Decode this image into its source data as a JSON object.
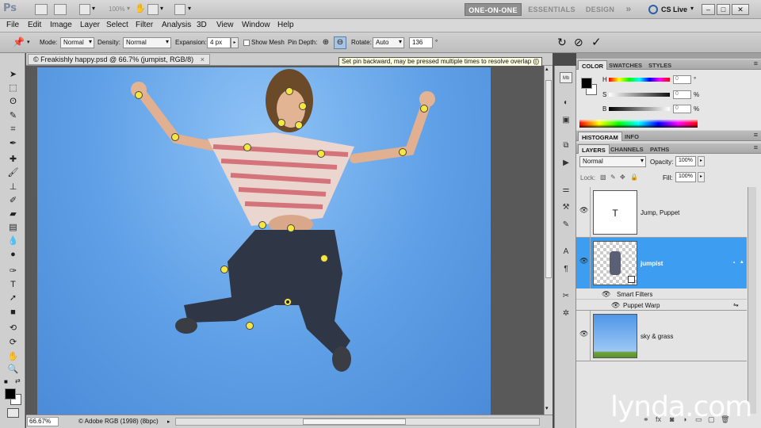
{
  "app": {
    "logo": "Ps",
    "zoom_select": "100%",
    "workspaces": [
      "ONE-ON-ONE",
      "ESSENTIALS",
      "DESIGN"
    ],
    "more_workspaces": "»",
    "cs_live": "CS Live"
  },
  "menu": [
    "File",
    "Edit",
    "Image",
    "Layer",
    "Select",
    "Filter",
    "Analysis",
    "3D",
    "View",
    "Window",
    "Help"
  ],
  "options": {
    "mode_label": "Mode:",
    "mode_value": "Normal",
    "density_label": "Density:",
    "density_value": "Normal",
    "expansion_label": "Expansion:",
    "expansion_value": "4 px",
    "show_mesh_label": "Show Mesh",
    "pin_depth_label": "Pin Depth:",
    "rotate_label": "Rotate:",
    "rotate_value": "Auto",
    "rotate_angle": "136",
    "tooltip": "Set pin backward, may be pressed multiple times to resolve overlap ([)"
  },
  "document": {
    "tab_title": "© Freakishly happy.psd @ 66.7% (jumpist, RGB/8)",
    "zoom": "66.67%",
    "profile": "© Adobe RGB (1998) (8bpc)"
  },
  "color_panel": {
    "tabs": [
      "COLOR",
      "SWATCHES",
      "STYLES"
    ],
    "channels": [
      {
        "label": "H",
        "value": "0",
        "unit": "°"
      },
      {
        "label": "S",
        "value": "0",
        "unit": "%"
      },
      {
        "label": "B",
        "value": "0",
        "unit": "%"
      }
    ]
  },
  "histogram_panel": {
    "tabs": [
      "HISTOGRAM",
      "INFO"
    ]
  },
  "layers_panel": {
    "tabs": [
      "LAYERS",
      "CHANNELS",
      "PATHS"
    ],
    "blend_mode": "Normal",
    "opacity_label": "Opacity:",
    "opacity_value": "100%",
    "lock_label": "Lock:",
    "fill_label": "Fill:",
    "fill_value": "100%",
    "layers": [
      {
        "name": "Jump, Puppet",
        "thumb_text": "T"
      },
      {
        "name": "jumpist"
      },
      {
        "name": "sky & grass"
      }
    ],
    "smart_filters_label": "Smart Filters",
    "filter_name": "Puppet Warp"
  },
  "watermark": "lynda.com",
  "colors": {
    "selection_blue": "#3d9ef1",
    "pin_yellow": "#f5e642"
  }
}
